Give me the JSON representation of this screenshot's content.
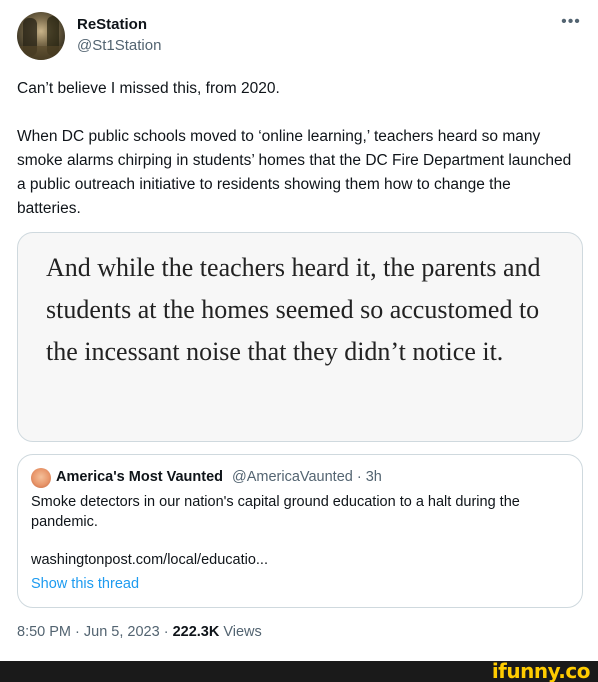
{
  "author": {
    "display_name": "ReStation",
    "handle": "@St1Station"
  },
  "more_icon": "more-horizontal-icon",
  "tweet": {
    "line1": "Can’t believe I missed this, from 2020.",
    "line2": "When DC public schools moved to ‘online learning,’ teachers heard so many smoke alarms chirping in students’ homes that the DC Fire Department launched a public outreach initiative to residents showing them how to change the batteries."
  },
  "media": {
    "quote_text": "And while the teachers heard it, the parents and students at the homes seemed so accustomed to the incessant noise that they didn’t notice it."
  },
  "quoted_tweet": {
    "name": "America's Most Vaunted",
    "handle_time": "@AmericaVaunted · 3h",
    "text": "Smoke detectors in our nation's capital ground education to a halt during the pandemic.",
    "link": "washingtonpost.com/local/educatio...",
    "show_thread": "Show this thread"
  },
  "meta": {
    "time": "8:50 PM · Jun 5, 2023 · ",
    "views_count": "222.3K",
    "views_label": " Views"
  },
  "watermark": {
    "text": "ifunny.co",
    "color": "#ffcc00"
  }
}
